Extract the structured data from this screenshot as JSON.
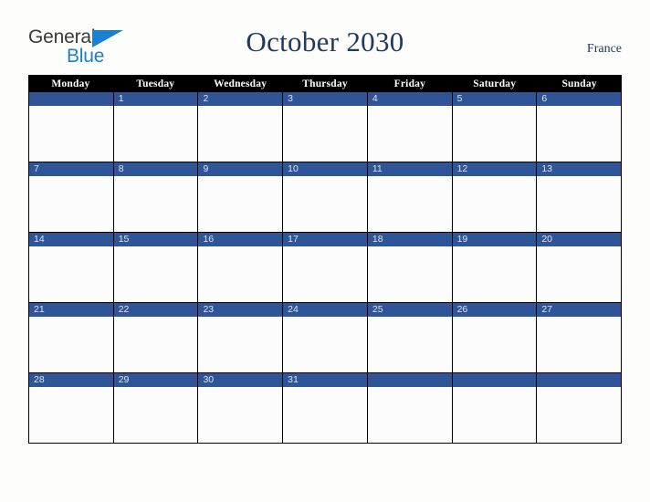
{
  "brand": {
    "name_part_1": "General",
    "name_part_2": "Blue",
    "triangle_icon": "blue-triangle-icon",
    "color_dark": "#3a3a3a",
    "color_blue": "#1b7fd4"
  },
  "header": {
    "title": "October 2030",
    "month": "October",
    "year": "2030",
    "country": "France",
    "title_color": "#22385f"
  },
  "calendar": {
    "weekday_headers": [
      "Monday",
      "Tuesday",
      "Wednesday",
      "Thursday",
      "Friday",
      "Saturday",
      "Sunday"
    ],
    "header_background": "#000000",
    "header_text_color": "#ffffff",
    "date_bar_color": "#2f5597",
    "date_text_color": "#dfe4ee",
    "cell_background": "#fcfcfd",
    "border_color": "#000000",
    "weeks": [
      {
        "days": [
          {
            "number": ""
          },
          {
            "number": "1"
          },
          {
            "number": "2"
          },
          {
            "number": "3"
          },
          {
            "number": "4"
          },
          {
            "number": "5"
          },
          {
            "number": "6"
          }
        ]
      },
      {
        "days": [
          {
            "number": "7"
          },
          {
            "number": "8"
          },
          {
            "number": "9"
          },
          {
            "number": "10"
          },
          {
            "number": "11"
          },
          {
            "number": "12"
          },
          {
            "number": "13"
          }
        ]
      },
      {
        "days": [
          {
            "number": "14"
          },
          {
            "number": "15"
          },
          {
            "number": "16"
          },
          {
            "number": "17"
          },
          {
            "number": "18"
          },
          {
            "number": "19"
          },
          {
            "number": "20"
          }
        ]
      },
      {
        "days": [
          {
            "number": "21"
          },
          {
            "number": "22"
          },
          {
            "number": "23"
          },
          {
            "number": "24"
          },
          {
            "number": "25"
          },
          {
            "number": "26"
          },
          {
            "number": "27"
          }
        ]
      },
      {
        "days": [
          {
            "number": "28"
          },
          {
            "number": "29"
          },
          {
            "number": "30"
          },
          {
            "number": "31"
          },
          {
            "number": ""
          },
          {
            "number": ""
          },
          {
            "number": ""
          }
        ]
      }
    ]
  },
  "page": {
    "background": "#fdfdfc"
  }
}
